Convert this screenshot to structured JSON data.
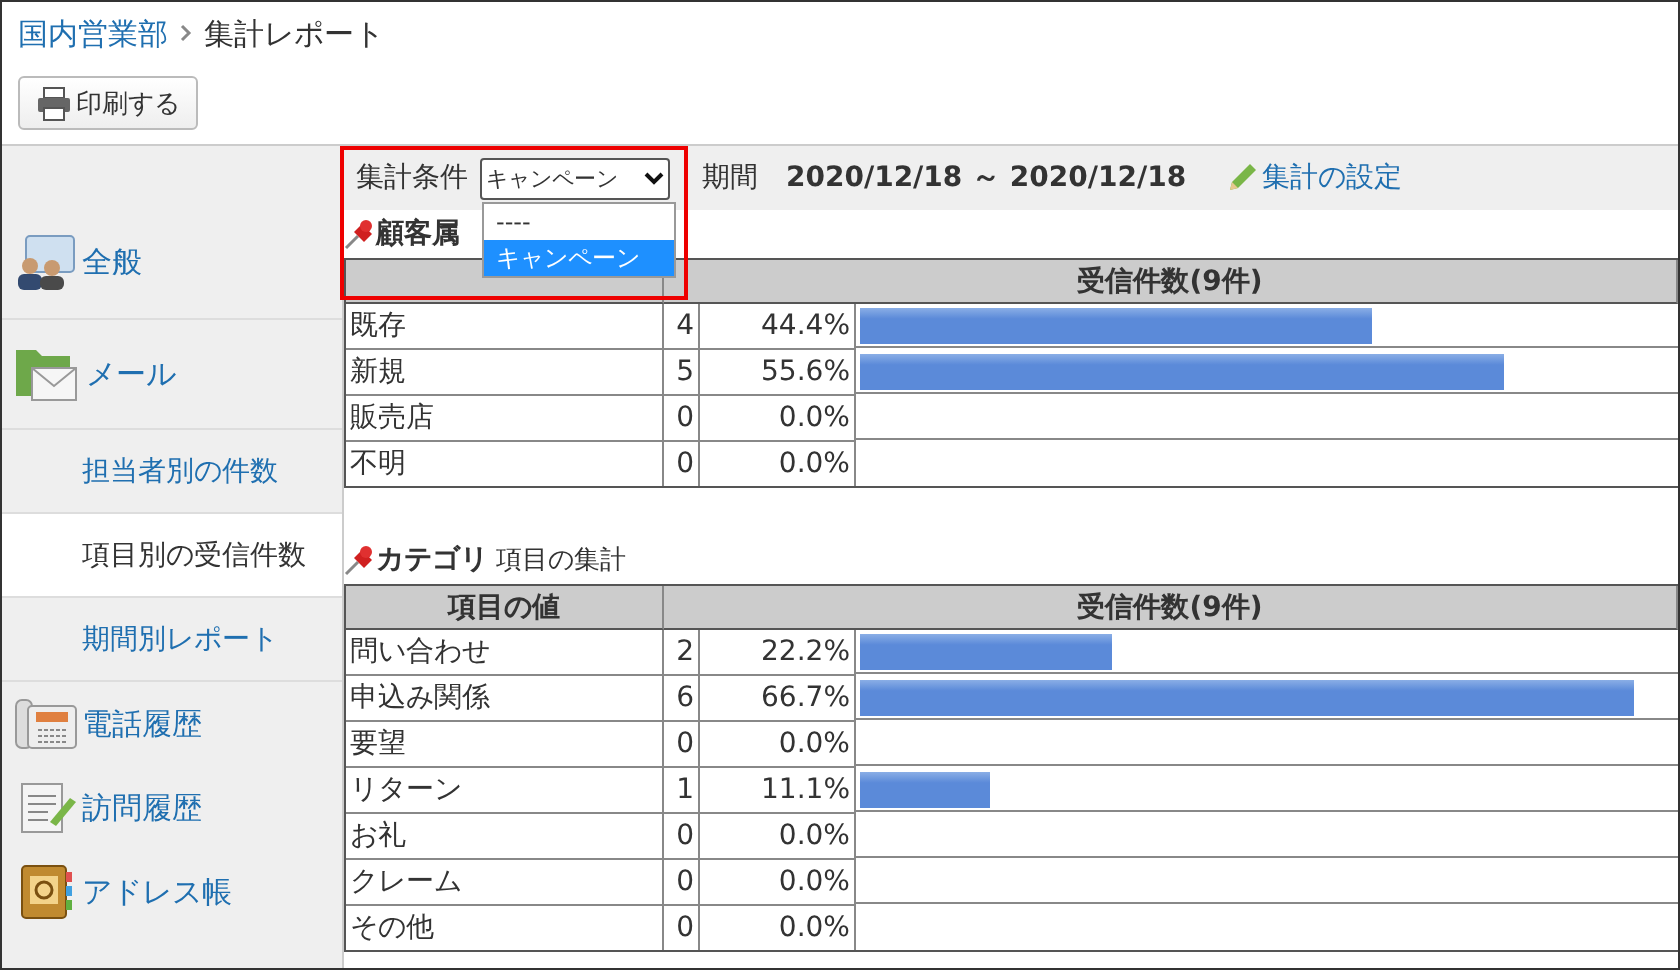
{
  "breadcrumb": [
    {
      "label": "国内営業部",
      "kind": "link"
    },
    {
      "label": "集計レポート",
      "kind": "current"
    }
  ],
  "toolbar": {
    "print_button": "印刷する"
  },
  "sidebar": {
    "items": [
      {
        "label": "全般",
        "selected": false
      },
      {
        "label": "メール",
        "selected": false,
        "children": [
          {
            "label": "担当者別の件数",
            "selected": false
          },
          {
            "label": "項目別の受信件数",
            "selected": true
          },
          {
            "label": "期間別レポート",
            "selected": false
          }
        ]
      },
      {
        "label": "電話履歴",
        "selected": false
      },
      {
        "label": "訪問履歴",
        "selected": false
      },
      {
        "label": "アドレス帳",
        "selected": false
      }
    ]
  },
  "filter": {
    "label": "集計条件",
    "select_value": "キャンペーン",
    "expanded": true,
    "options": [
      {
        "label": "----",
        "selected": false
      },
      {
        "label": "キャンペーン",
        "selected": true
      }
    ],
    "period_label": "期間",
    "period_value": "2020/12/18 ～ 2020/12/18",
    "settings_link": "集計の設定"
  },
  "sections": [
    {
      "title": "顧客属",
      "header_count": "受信件数(9件)",
      "rows": [
        {
          "label": "既存",
          "count": "4",
          "percent": "44.4%",
          "level": 0.63
        },
        {
          "label": "新規",
          "count": "5",
          "percent": "55.6%",
          "level": 0.79
        },
        {
          "label": "販売店",
          "count": "0",
          "percent": "0.0%"
        },
        {
          "label": "不明",
          "count": "0",
          "percent": "0.0%"
        }
      ]
    },
    {
      "title": "カテゴリ",
      "subtitle": "項目の集計",
      "header_label": "項目の値",
      "header_count": "受信件数(9件)",
      "rows": [
        {
          "label": "問い合わせ",
          "count": "2",
          "percent": "22.2%",
          "level": 0.31
        },
        {
          "label": "申込み関係",
          "count": "6",
          "percent": "66.7%",
          "level": 0.95
        },
        {
          "label": "要望",
          "count": "0",
          "percent": "0.0%"
        },
        {
          "label": "リターン",
          "count": "1",
          "percent": "11.1%",
          "level": 0.16
        },
        {
          "label": "お礼",
          "count": "0",
          "percent": "0.0%"
        },
        {
          "label": "クレーム",
          "count": "0",
          "percent": "0.0%"
        },
        {
          "label": "その他",
          "count": "0",
          "percent": "0.0%"
        }
      ]
    }
  ]
}
